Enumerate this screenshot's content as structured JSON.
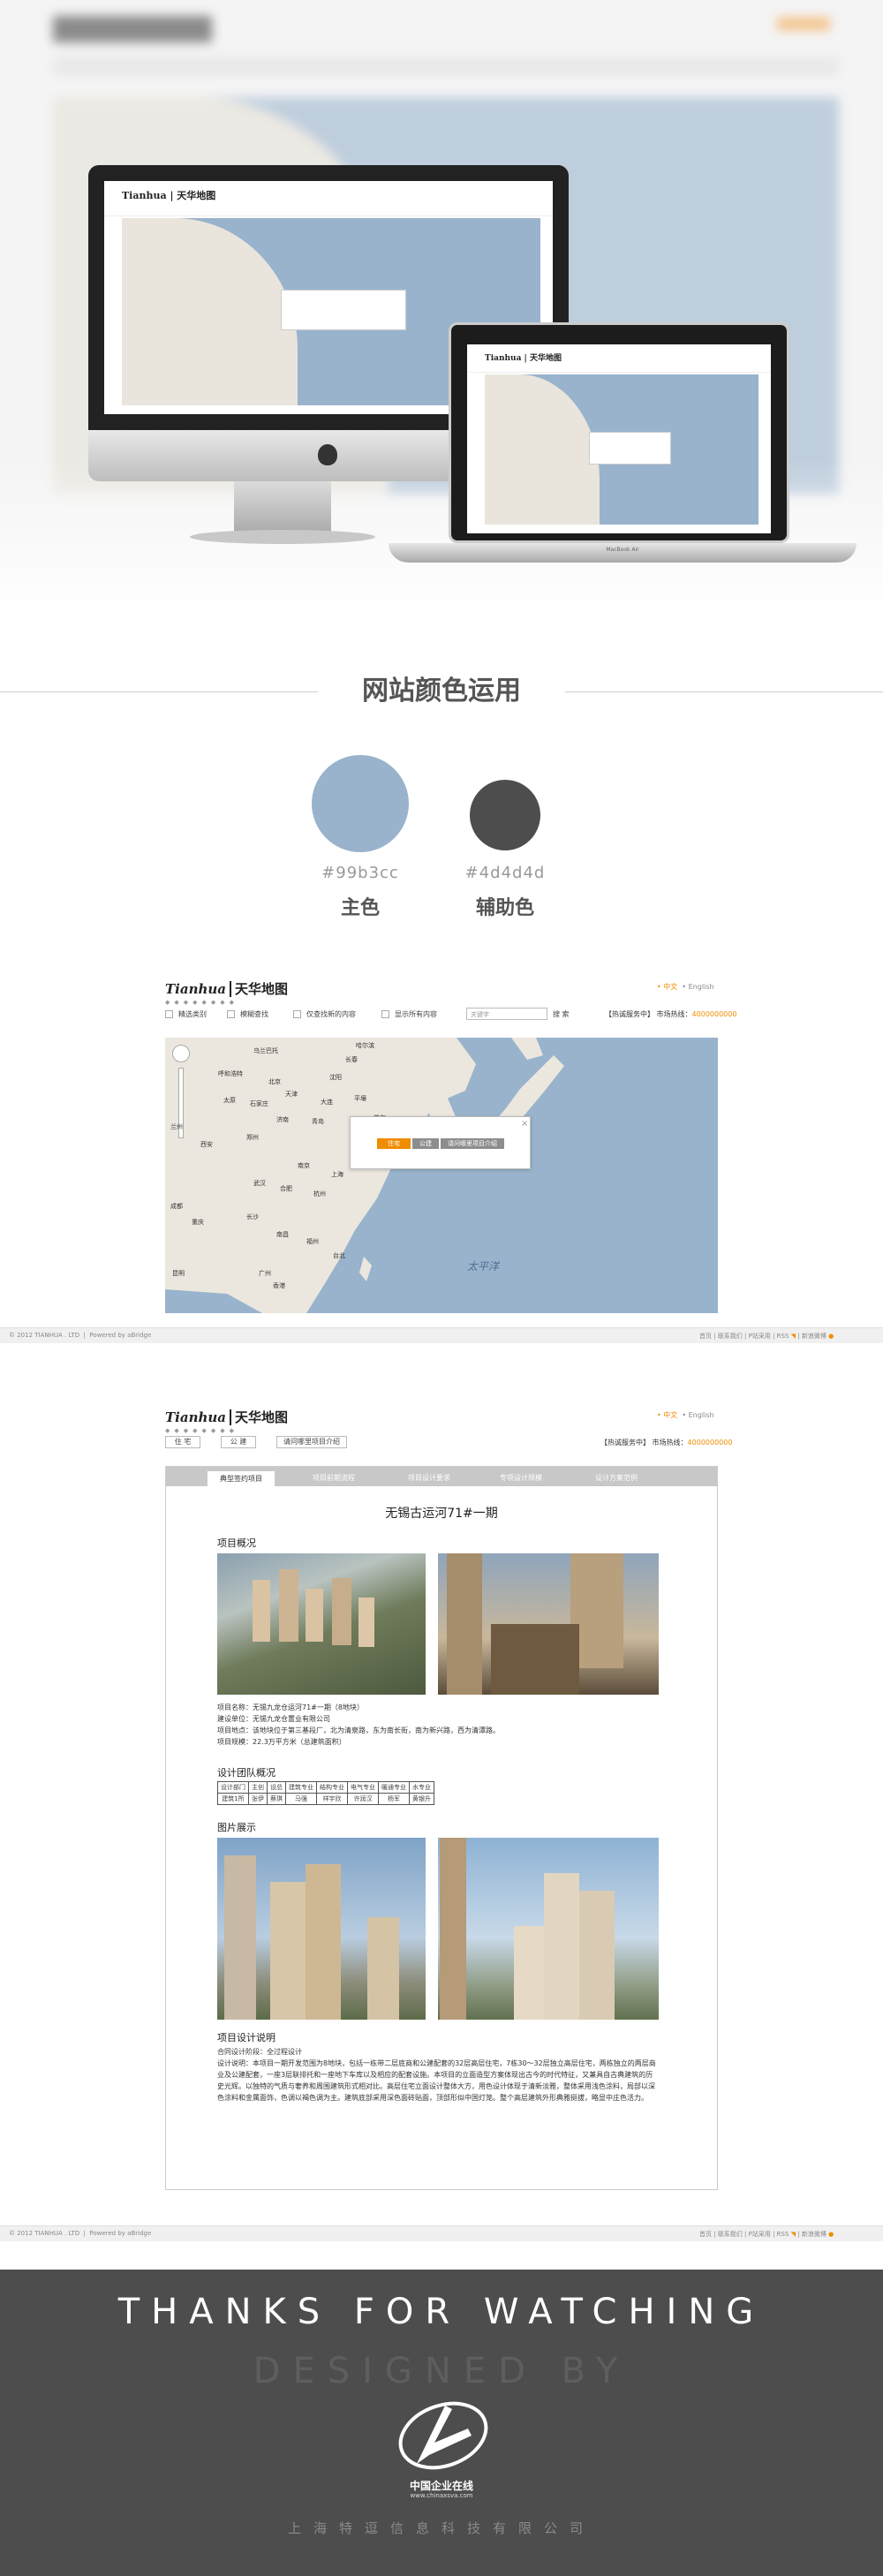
{
  "mock_site": {
    "logo_en": "Tianhua",
    "logo_cn": "天华地图",
    "lang_cn": "• 中文",
    "lang_en": "• English",
    "filters": [
      "精选类别",
      "模糊查找",
      "仅查找新的内容",
      "显示所有内容"
    ],
    "search_placeholder": "关键字",
    "search_button": "搜 索",
    "hotline_label": "【热诚服务中】 市场热线：",
    "hotline_number": "4000000000",
    "map_cities": [
      "北京",
      "天津",
      "石家庄",
      "太原",
      "济南",
      "青岛",
      "郑州",
      "西安",
      "南京",
      "上海",
      "武汉",
      "长沙",
      "杭州",
      "福州",
      "广州",
      "香港",
      "台北",
      "大连",
      "沈阳",
      "长春",
      "哈尔滨",
      "首尔",
      "平壤",
      "东京",
      "成都",
      "重庆",
      "昆明",
      "南昌",
      "合肥",
      "兰州",
      "呼和浩特",
      "乌兰巴托"
    ],
    "ocean_label": "太平洋",
    "popup_tabs": [
      "住宅",
      "公建",
      "请问哪里项目介绍"
    ],
    "footer_copy": "© 2012 TIANHUA . LTD",
    "footer_powered": "Powered by aBridge",
    "footer_links": [
      "首页",
      "联系我们",
      "P站采用",
      "RSS",
      "新浪微博"
    ]
  },
  "monitor_brand": "MacBook Air",
  "colors": {
    "section_title": "网站颜色运用",
    "primary": {
      "hex": "#99b3cc",
      "label": "主色"
    },
    "secondary": {
      "hex": "#4d4d4d",
      "label": "辅助色"
    }
  },
  "detail": {
    "sub_buttons": [
      "住 宅",
      "公 建",
      "请问哪里项目介绍"
    ],
    "nav_tabs": [
      "典型签约项目",
      "项目前期流程",
      "项目设计要求",
      "专项设计规模",
      "设计方案范例"
    ],
    "title": "无锡古运河71#一期",
    "overview_heading": "项目概况",
    "overview_lines": [
      "项目名称：无锡九龙仓运河71#一期（8地块）",
      "建设单位：无锡九龙仓置业有限公司",
      "项目地点：该地块位于第三基段厂，北为清泉路，东为南长街，南为新兴路，西为清潭路。",
      "项目规模：22.3万平方米（总建筑面积）"
    ],
    "team_heading": "设计团队概况",
    "team_row1": [
      "设计部门",
      "主创",
      "设总",
      "建筑专业",
      "结构专业",
      "电气专业",
      "暖通专业",
      "水专业"
    ],
    "team_row2": [
      "建筑1所",
      "张伊",
      "蔡琪",
      "马强",
      "祥宇欣",
      "许润汉",
      "杨军",
      "黄银升"
    ],
    "gallery_heading": "图片展示",
    "desc_heading": "项目设计说明",
    "desc_lines": [
      "合同设计阶段：全过程设计",
      "设计说明：本项目一期开发范围为8地块，包括一栋带二层底商和公建配套的32层高层住宅，7栋30～32层独立高层住宅，两栋独立的两层商业及公建配套，一座3层联排托和一座地下车库以及相应的配套设施。本项目的立面造型方案体现出古今的时代特征，又兼具自古典建筑的历史光辉。以独特的气质与奢养和周围建筑形式相对比。高层住宅立面设计整体大方，用色设计体现于清新淡雅，整体采用浅色涂料，局部以深色涂料和金属面饰，色调以褐色调为主。建筑底部采用深色面砖贴面，顶部形似中国灯笼。整个高层建筑外形典雅挺拔，略显中庄色活力。"
    ]
  },
  "final": {
    "thanks": "THANKS FOR WATCHING",
    "designed_by": "DESIGNED BY",
    "brand_name": "中国企业在线",
    "brand_url": "www.chinaxsva.com",
    "company": "上海特逗信息科技有限公司"
  }
}
